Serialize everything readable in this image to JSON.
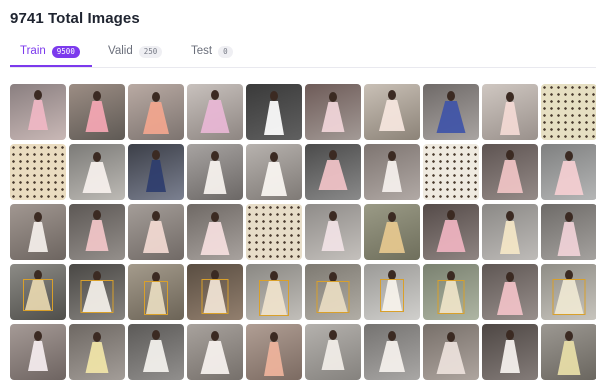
{
  "page": {
    "title": "9741 Total Images"
  },
  "tabs": [
    {
      "label": "Train",
      "count": "9500",
      "active": true
    },
    {
      "label": "Valid",
      "count": "250",
      "active": false
    },
    {
      "label": "Test",
      "count": "0",
      "active": false
    }
  ],
  "accent_color": "#7c3aed",
  "thumbnail_rows": 5,
  "thumbnail_columns": 10
}
